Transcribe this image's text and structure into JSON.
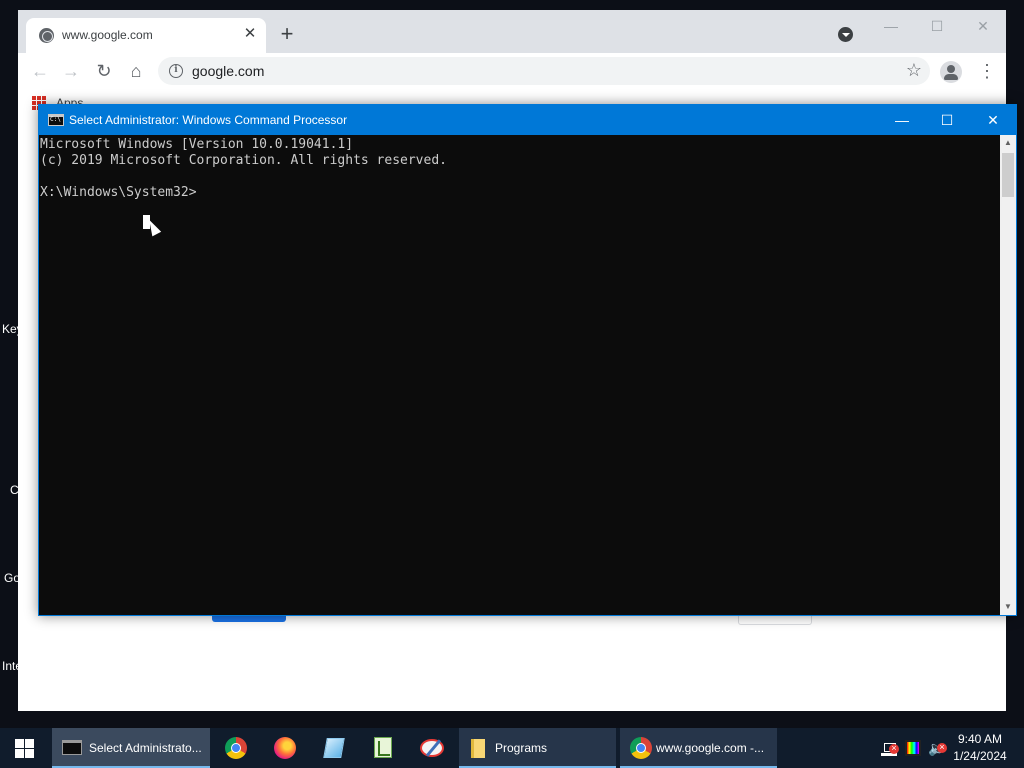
{
  "desktop": {
    "labels": [
      "Key",
      "C",
      "Go",
      "Inte"
    ]
  },
  "chrome": {
    "tab": {
      "title": "www.google.com",
      "close": "✕"
    },
    "new_tab": "+",
    "window_buttons": {
      "minimize": "—",
      "maximize": "☐",
      "close": "✕"
    },
    "nav": {
      "back": "←",
      "forward": "→",
      "reload": "↻",
      "home": "⌂"
    },
    "omnibox": {
      "info": "i",
      "url": "google.com",
      "star": "☆"
    },
    "menu": "⋮",
    "bookmarks": {
      "apps_label": "Apps"
    }
  },
  "cmd": {
    "title": "Select Administrator: Windows Command Processor",
    "window_buttons": {
      "minimize": "—",
      "maximize": "☐",
      "close": "✕"
    },
    "lines": [
      "Microsoft Windows [Version 10.0.19041.1]",
      "(c) 2019 Microsoft Corporation. All rights reserved.",
      "",
      "X:\\Windows\\System32>"
    ],
    "scroll": {
      "up": "▲",
      "down": "▼"
    }
  },
  "taskbar": {
    "items": [
      {
        "label": "Select Administrato...",
        "icon": "cmd-icon",
        "state": "active"
      },
      {
        "label": "",
        "icon": "chrome-icon",
        "state": "pinned"
      },
      {
        "label": "",
        "icon": "firefox-icon",
        "state": "pinned"
      },
      {
        "label": "",
        "icon": "notepad-icon",
        "state": "pinned"
      },
      {
        "label": "",
        "icon": "spreadsheet-icon",
        "state": "pinned"
      },
      {
        "label": "",
        "icon": "paint-icon",
        "state": "pinned"
      },
      {
        "label": "Programs",
        "icon": "folder-icon",
        "state": "open"
      },
      {
        "label": "www.google.com -...",
        "icon": "chrome-icon",
        "state": "open"
      }
    ],
    "tray": {
      "volume": "🔈"
    },
    "clock": {
      "time": "9:40 AM",
      "date": "1/24/2024"
    }
  },
  "colors": {
    "cmd_titlebar": "#0078d7",
    "taskbar": "#101c2c",
    "chrome_tabbar": "#dee1e6"
  }
}
